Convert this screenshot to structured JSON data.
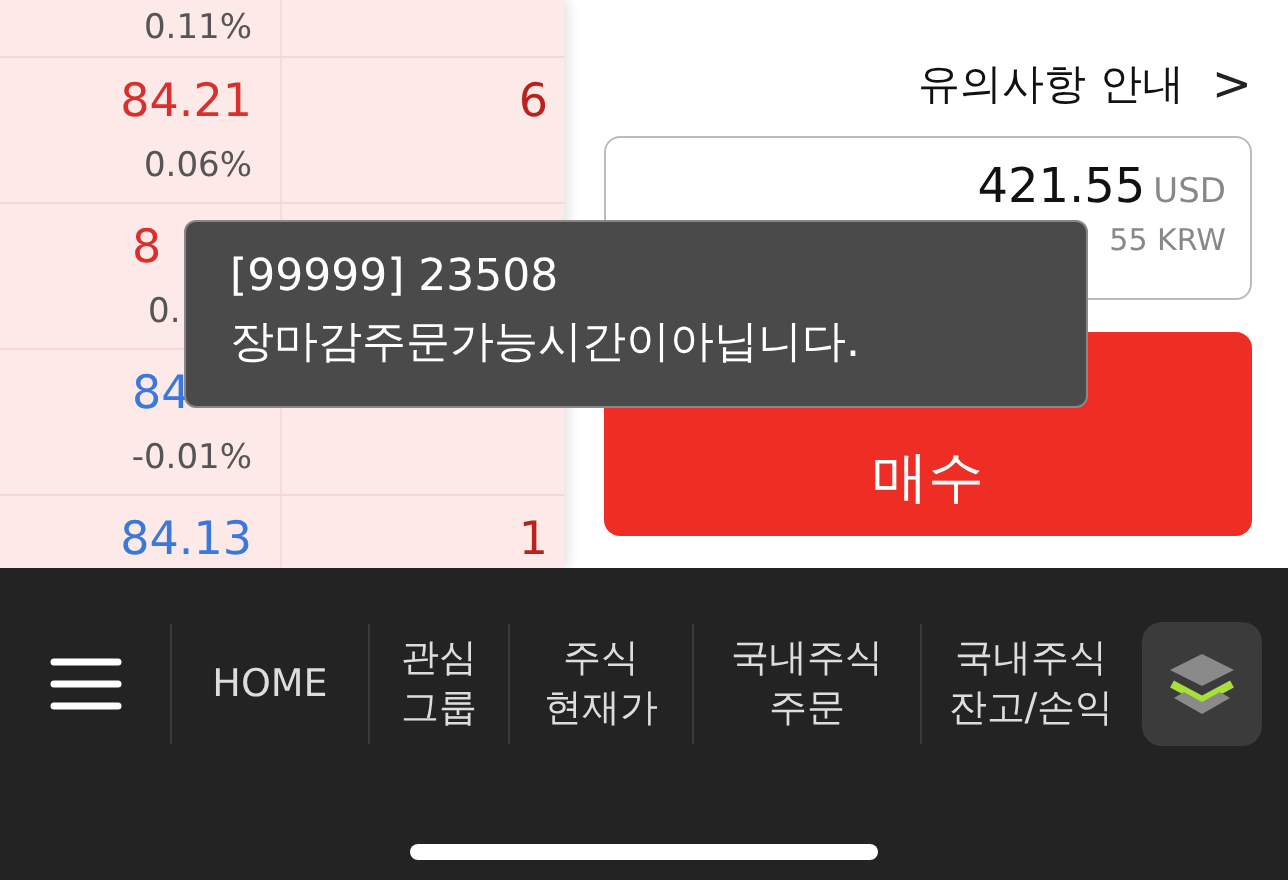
{
  "order_book": {
    "rows": [
      {
        "change": "0.11%"
      },
      {
        "color": "#d9302c",
        "price": "84.21",
        "change": "0.06%",
        "quantity": "6"
      },
      {
        "color": "#d9302c",
        "price": "8",
        "price_clipped": true,
        "change": "0.",
        "change_clipped": true
      },
      {
        "color": "#3a78dc",
        "price": "84",
        "price_clipped": true,
        "change": "-0.01%"
      },
      {
        "color": "#3a78dc",
        "price": "84.13",
        "quantity": "1"
      }
    ]
  },
  "notice_link": {
    "label": "유의사항 안내",
    "icon": ">"
  },
  "order_amount": {
    "value": "421.55",
    "currency": "USD",
    "converted": "55 KRW"
  },
  "buy_button": {
    "label": "매수"
  },
  "toast": {
    "lines": [
      "[99999] 23508",
      "장마감주문가능시간이아닙니다."
    ]
  },
  "bottom_nav": {
    "items": [
      {
        "kind": "menu"
      },
      {
        "kind": "text",
        "label": "HOME"
      },
      {
        "kind": "text",
        "label": "관심\n그룹"
      },
      {
        "kind": "text",
        "label": "주식\n현재가"
      },
      {
        "kind": "text",
        "label": "국내주식\n주문"
      },
      {
        "kind": "text",
        "label": "국내주식\n잔고/손익"
      },
      {
        "kind": "layers"
      }
    ]
  }
}
